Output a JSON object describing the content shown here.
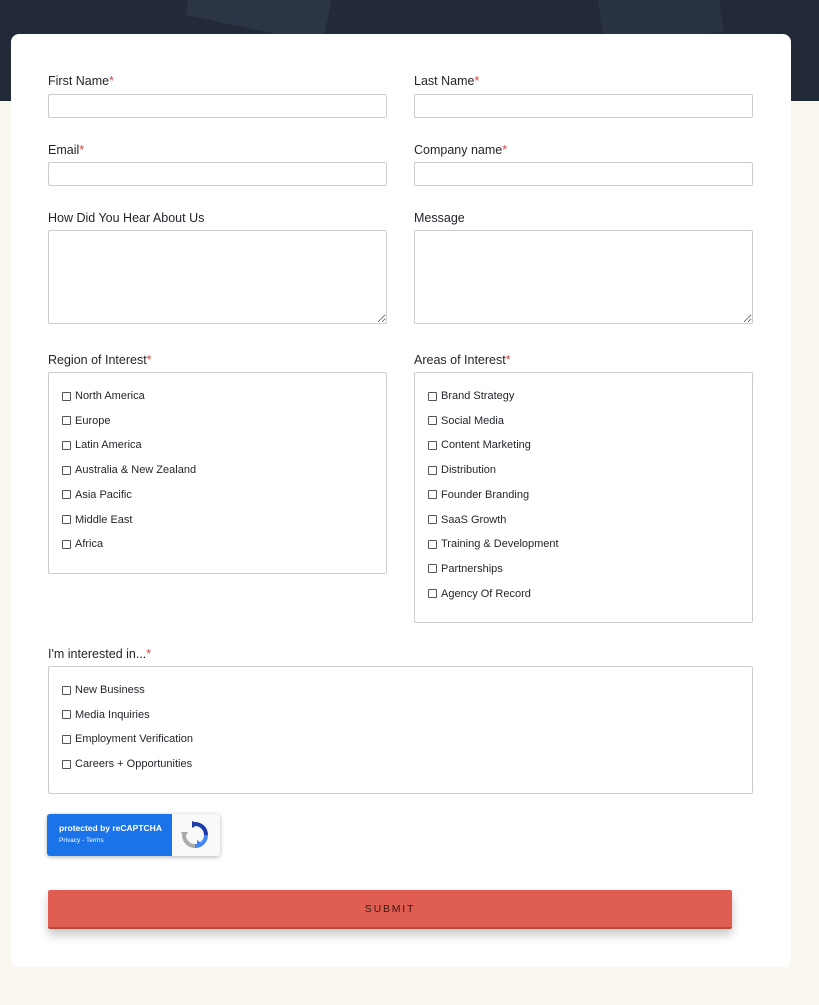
{
  "form": {
    "first_name": {
      "label": "First Name",
      "required": "*",
      "value": ""
    },
    "last_name": {
      "label": "Last Name",
      "required": "*",
      "value": ""
    },
    "email": {
      "label": "Email",
      "required": "*",
      "value": ""
    },
    "company": {
      "label": "Company name",
      "required": "*",
      "value": ""
    },
    "hear_about": {
      "label": "How Did You Hear About Us",
      "value": ""
    },
    "message": {
      "label": "Message",
      "value": ""
    },
    "region": {
      "label": "Region of Interest",
      "required": "*",
      "options": [
        "North America",
        "Europe",
        "Latin America",
        "Australia & New Zealand",
        "Asia Pacific",
        "Middle East",
        "Africa"
      ]
    },
    "areas": {
      "label": "Areas of Interest",
      "required": "*",
      "options": [
        "Brand Strategy",
        "Social Media",
        "Content Marketing",
        "Distribution",
        "Founder Branding",
        "SaaS Growth",
        "Training & Development",
        "Partnerships",
        "Agency Of Record"
      ]
    },
    "interested": {
      "label": "I'm interested in...",
      "required": "*",
      "options": [
        "New Business",
        "Media Inquiries",
        "Employment Verification",
        "Careers + Opportunities"
      ]
    },
    "recaptcha": {
      "line1": "protected by reCAPTCHA",
      "line2": "Privacy - Terms",
      "icon": "recaptcha-logo-icon"
    },
    "submit_label": "SUBMIT"
  },
  "colors": {
    "accent": "#e05e51",
    "required": "#d64545",
    "hero": "#222a38",
    "page": "#faf6f0",
    "recaptcha_blue": "#1a73e8"
  }
}
